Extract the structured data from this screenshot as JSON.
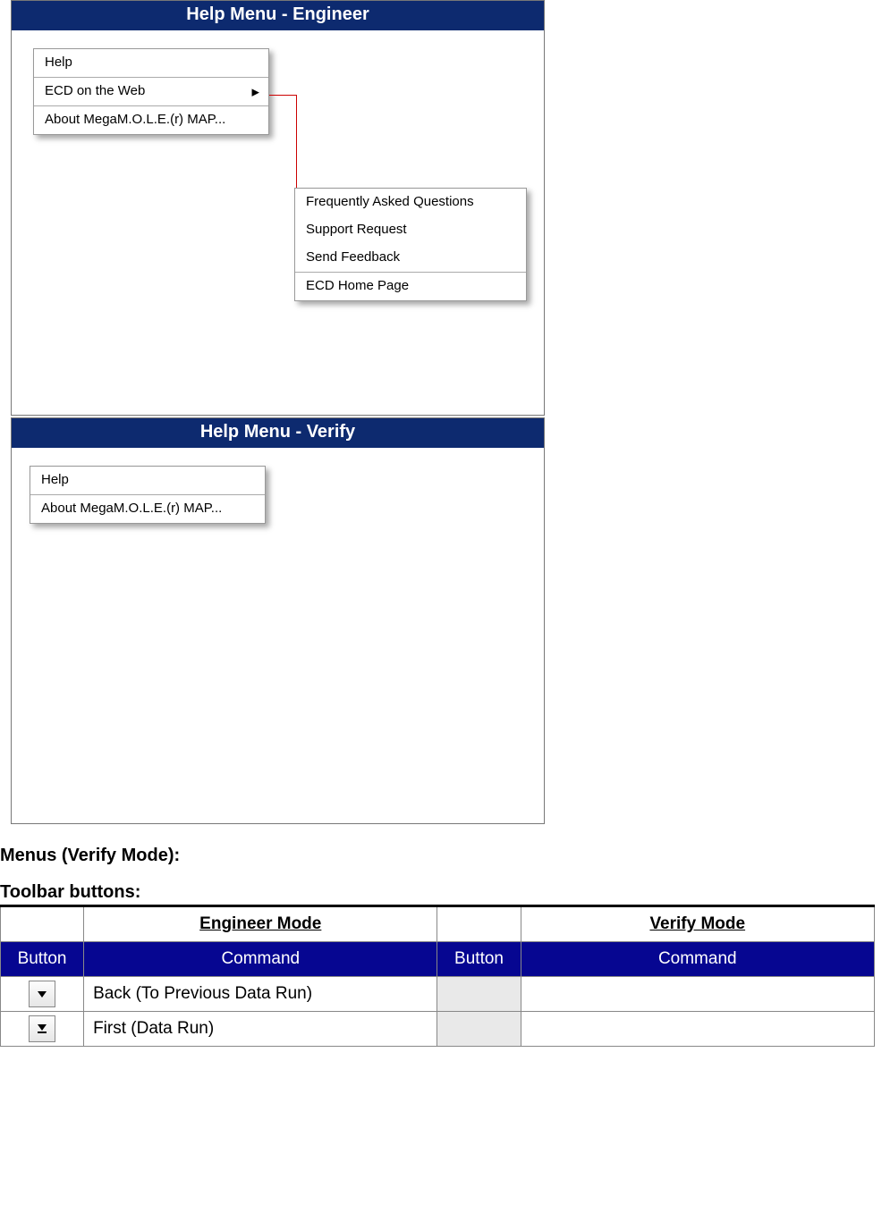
{
  "figures": {
    "engineer": {
      "title": "Help Menu - Engineer",
      "menu": {
        "items": [
          "Help",
          "ECD on the Web",
          "About MegaM.O.L.E.(r) MAP..."
        ]
      },
      "submenu": {
        "items": [
          "Frequently Asked Questions",
          "Support Request",
          "Send Feedback",
          "ECD Home Page"
        ]
      }
    },
    "verify": {
      "title": "Help Menu - Verify",
      "menu": {
        "items": [
          "Help",
          "About MegaM.O.L.E.(r) MAP..."
        ]
      }
    }
  },
  "text": {
    "menus_verify_heading": "Menus (Verify Mode):",
    "toolbar_heading": "Toolbar buttons:"
  },
  "table": {
    "group_headers": [
      "Engineer Mode",
      "Verify Mode"
    ],
    "col_headers": [
      "Button",
      "Command",
      "Button",
      "Command"
    ],
    "rows": [
      {
        "icon": "down-arrow",
        "engineer_cmd": "Back (To Previous Data Run)",
        "verify_cmd": ""
      },
      {
        "icon": "down-bar-arrow",
        "engineer_cmd": "First (Data Run)",
        "verify_cmd": ""
      }
    ]
  }
}
